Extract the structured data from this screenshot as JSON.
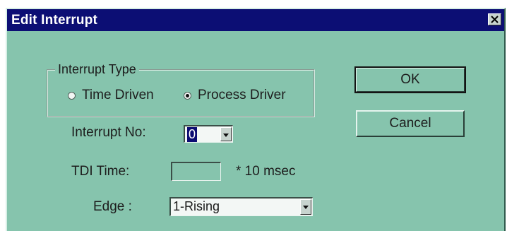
{
  "window": {
    "title": "Edit Interrupt"
  },
  "interrupt_type": {
    "legend": "Interrupt Type",
    "options": [
      {
        "label": "Time Driven",
        "selected": false
      },
      {
        "label": "Process Driver",
        "selected": true
      }
    ]
  },
  "interrupt_no": {
    "label": "Interrupt No:",
    "value": "0"
  },
  "tdi_time": {
    "label": "TDI Time:",
    "value": "",
    "unit": "* 10 msec"
  },
  "edge": {
    "label": "Edge :",
    "value": "1-Rising"
  },
  "buttons": {
    "ok": "OK",
    "cancel": "Cancel"
  },
  "colors": {
    "titlebar": "#0c0e74",
    "dialog_bg": "#86c4ad"
  },
  "icons": {
    "close": "close-icon",
    "dropdown": "chevron-down-icon"
  }
}
